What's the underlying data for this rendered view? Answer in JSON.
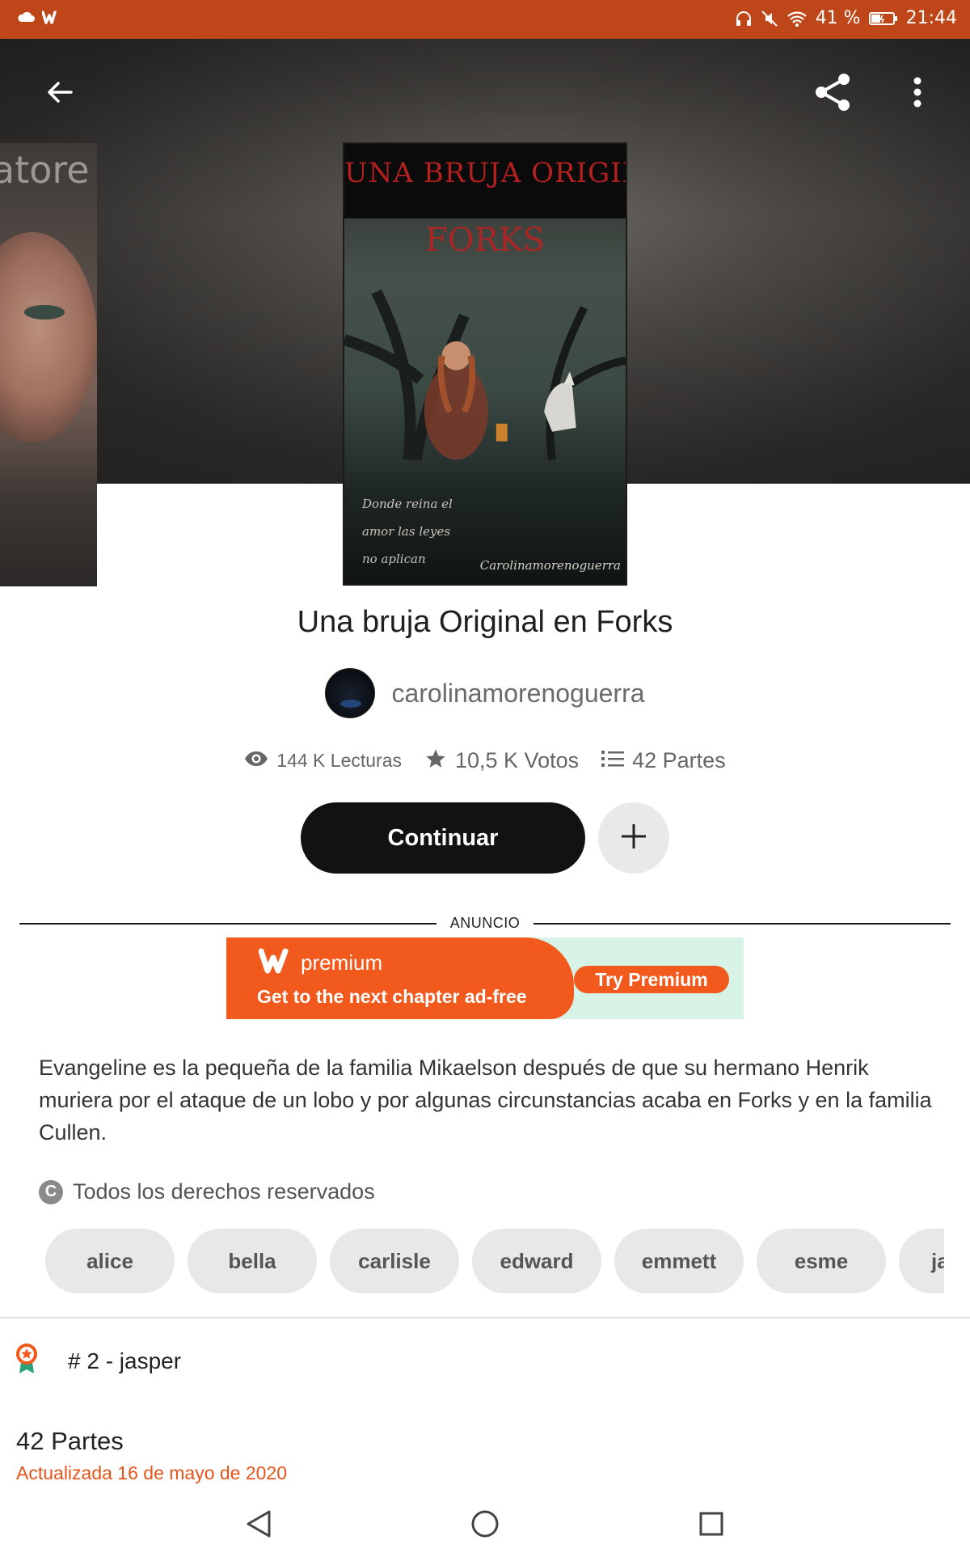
{
  "status": {
    "battery": "41 %",
    "time": "21:44"
  },
  "side_cover": {
    "text": "atore"
  },
  "cover": {
    "title_line1": "UNA BRUJA ORIGINAL EN",
    "title_line2": "FORKS",
    "quote": "Donde reina el amor las leyes no aplican",
    "author": "Carolinamorenoguerra"
  },
  "story": {
    "title": "Una bruja Original en Forks",
    "author": "carolinamorenoguerra",
    "reads": "144 K Lecturas",
    "votes": "10,5 K Votos",
    "parts": "42 Partes"
  },
  "actions": {
    "continue_label": "Continuar"
  },
  "ad": {
    "label": "ANUNCIO",
    "brand": "premium",
    "tagline": "Get to the next chapter ad-free",
    "cta": "Try Premium"
  },
  "description": "Evangeline es la pequeña de la familia Mikaelson después de que su hermano Henrik muriera por el ataque de un lobo y por algunas circunstancias acaba en Forks y en la familia Cullen.",
  "rights": "Todos los derechos reservados",
  "tags": [
    "alice",
    "bella",
    "carlisle",
    "edward",
    "emmett",
    "esme",
    "ja"
  ],
  "ranking": "# 2 - jasper",
  "toc": {
    "parts": "42 Partes",
    "updated": "Actualizada 16 de mayo de 2020"
  },
  "colors": {
    "brand_orange": "#f25a1d",
    "status_bar": "#bf4619",
    "accent_text": "#e8541a"
  }
}
